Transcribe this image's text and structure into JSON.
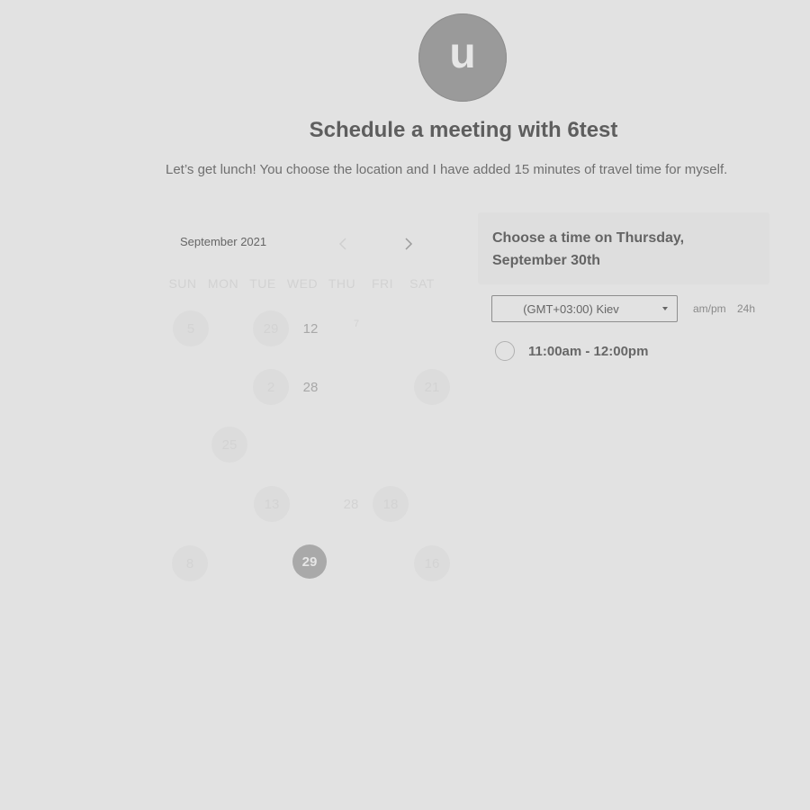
{
  "profile": {
    "avatar_letter": "u"
  },
  "header": {
    "title": "Schedule a meeting with 6test",
    "description": "Let’s get lunch! You choose the location and I have added 15 minutes of travel time for myself."
  },
  "calendar": {
    "month_label": "September 2021",
    "weekdays": [
      "SUN",
      "MON",
      "TUE",
      "WED",
      "THU",
      "FRI",
      "SAT"
    ],
    "days": [
      {
        "label": "5",
        "style": "bg"
      },
      {
        "label": "29",
        "style": "bg"
      },
      {
        "label": "12",
        "style": "dark"
      },
      {
        "label": "7",
        "style": ""
      },
      {
        "label": "28",
        "style": ""
      },
      {
        "label": "2",
        "style": "bg"
      },
      {
        "label": "28",
        "style": "dark"
      },
      {
        "label": "21",
        "style": "bg"
      },
      {
        "label": "25",
        "style": "bg"
      },
      {
        "label": "13",
        "style": "bg"
      },
      {
        "label": "28",
        "style": ""
      },
      {
        "label": "18",
        "style": "bg"
      },
      {
        "label": "8",
        "style": "bg"
      },
      {
        "label": "29",
        "style": "sel"
      },
      {
        "label": "16",
        "style": "bg"
      }
    ],
    "prev_icon": "chevron-left-icon",
    "next_icon": "chevron-right-icon"
  },
  "time_panel": {
    "title": "Choose a time on Thursday, September 30th",
    "timezone": "(GMT+03:00) Kiev",
    "format_12h": "am/pm",
    "format_24h": "24h",
    "slots": [
      {
        "label": "11:00am - 12:00pm"
      }
    ]
  }
}
